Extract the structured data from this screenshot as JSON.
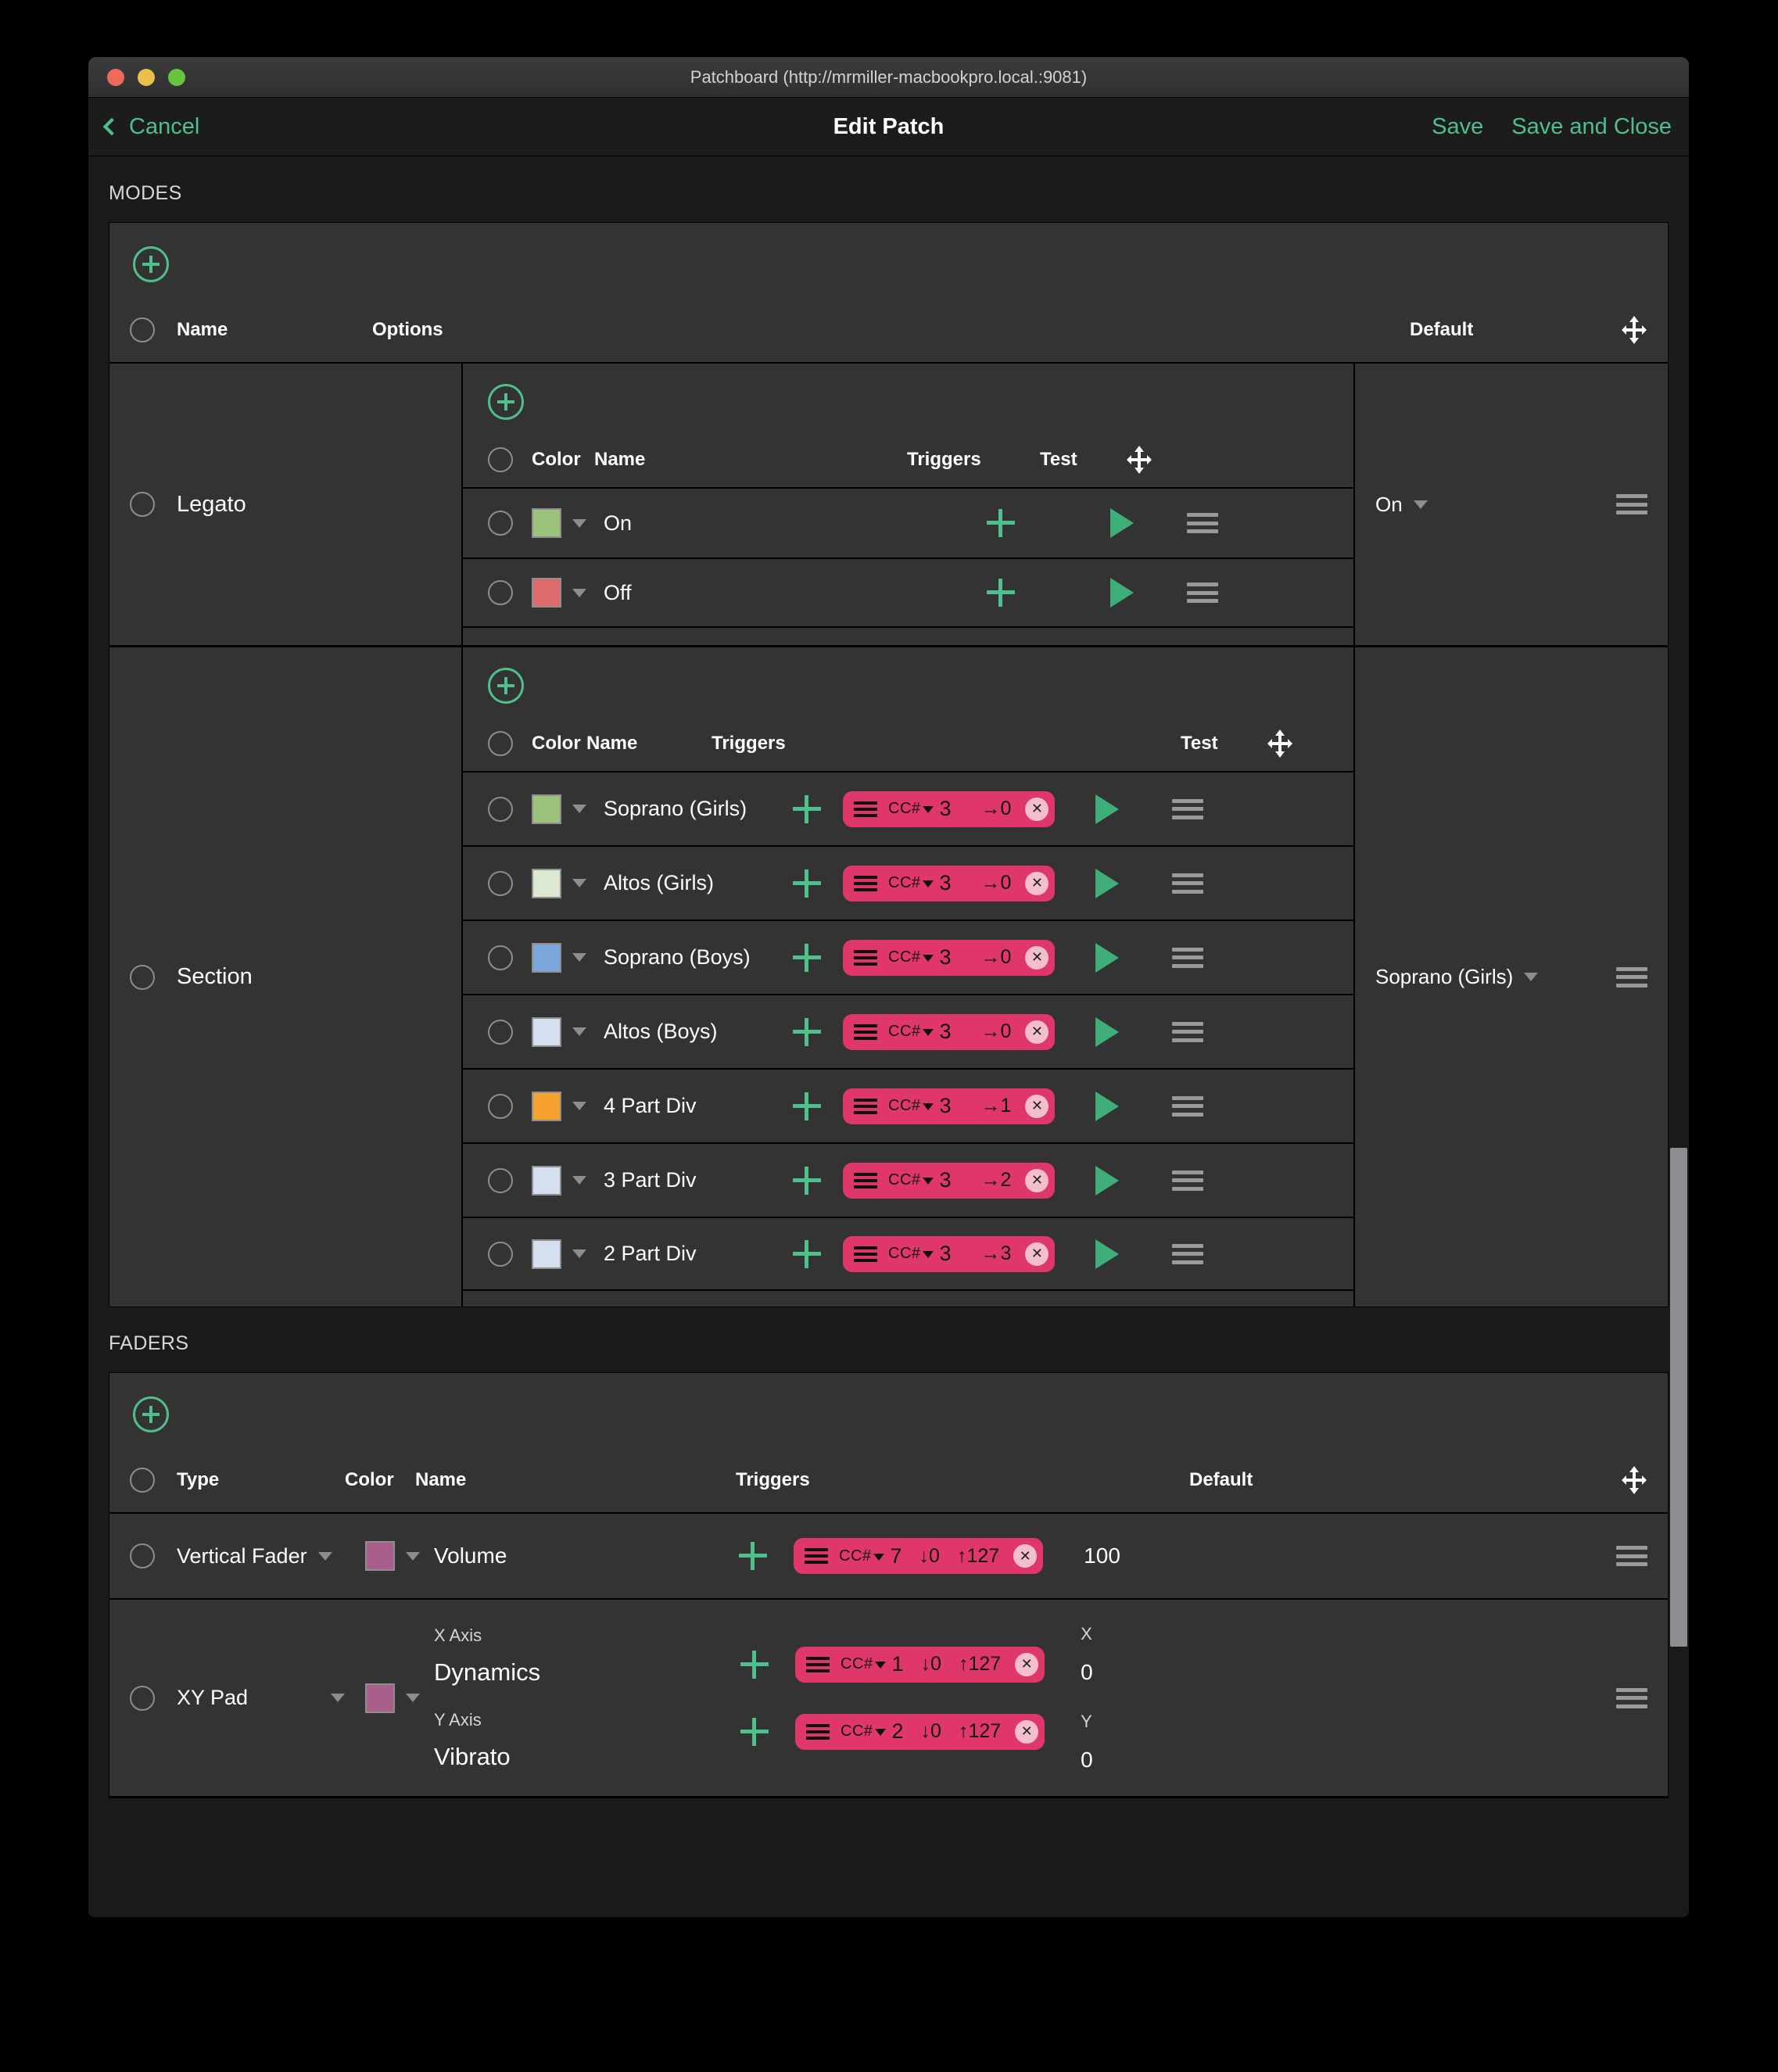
{
  "window": {
    "title": "Patchboard (http://mrmiller-macbookpro.local.:9081)",
    "traffic_lights": [
      "close",
      "minimize",
      "maximize"
    ]
  },
  "navbar": {
    "back_label": "Cancel",
    "title": "Edit Patch",
    "save_label": "Save",
    "save_close_label": "Save and Close"
  },
  "modes": {
    "section_label": "MODES",
    "add_label": "add-mode",
    "columns": {
      "name": "Name",
      "options": "Options",
      "default": "Default"
    },
    "option_columns": {
      "color": "Color",
      "name": "Name",
      "triggers": "Triggers",
      "test": "Test"
    },
    "items": [
      {
        "name": "Legato",
        "default": "On",
        "options": [
          {
            "color": "#9bc37c",
            "name": "On",
            "triggers": []
          },
          {
            "color": "#dd6b6b",
            "name": "Off",
            "triggers": []
          }
        ]
      },
      {
        "name": "Section",
        "default": "Soprano (Girls)",
        "options": [
          {
            "color": "#9bc37c",
            "name": "Soprano (Girls)",
            "triggers": [
              {
                "type": "CC#",
                "number": "3",
                "value": "→0"
              }
            ]
          },
          {
            "color": "#dde8d3",
            "name": "Altos (Girls)",
            "triggers": [
              {
                "type": "CC#",
                "number": "3",
                "value": "→0"
              }
            ]
          },
          {
            "color": "#7ba7dc",
            "name": "Soprano (Boys)",
            "triggers": [
              {
                "type": "CC#",
                "number": "3",
                "value": "→0"
              }
            ]
          },
          {
            "color": "#d4e0f0",
            "name": "Altos (Boys)",
            "triggers": [
              {
                "type": "CC#",
                "number": "3",
                "value": "→0"
              }
            ]
          },
          {
            "color": "#f5a231",
            "name": "4 Part Div",
            "triggers": [
              {
                "type": "CC#",
                "number": "3",
                "value": "→1"
              }
            ]
          },
          {
            "color": "#d4e0f0",
            "name": "3 Part Div",
            "triggers": [
              {
                "type": "CC#",
                "number": "3",
                "value": "→2"
              }
            ]
          },
          {
            "color": "#d4e0f0",
            "name": "2 Part Div",
            "triggers": [
              {
                "type": "CC#",
                "number": "3",
                "value": "→3"
              }
            ]
          }
        ]
      }
    ]
  },
  "faders": {
    "section_label": "FADERS",
    "add_label": "add-fader",
    "columns": {
      "type": "Type",
      "color": "Color",
      "name": "Name",
      "triggers": "Triggers",
      "default": "Default"
    },
    "items": [
      {
        "kind": "single",
        "type": "Vertical Fader",
        "color": "#a8608b",
        "name": "Volume",
        "trigger": {
          "type": "CC#",
          "number": "7",
          "min": "↓0",
          "max": "↑127"
        },
        "default": "100"
      },
      {
        "kind": "xy",
        "type": "XY Pad",
        "color": "#a8608b",
        "axes": [
          {
            "axis_label": "X Axis",
            "name": "Dynamics",
            "default_label": "X",
            "default": "0",
            "trigger": {
              "type": "CC#",
              "number": "1",
              "min": "↓0",
              "max": "↑127"
            }
          },
          {
            "axis_label": "Y Axis",
            "name": "Vibrato",
            "default_label": "Y",
            "default": "0",
            "trigger": {
              "type": "CC#",
              "number": "2",
              "min": "↓0",
              "max": "↑127"
            }
          }
        ]
      }
    ]
  },
  "theme": {
    "accent_green": "#4fbf8b",
    "pill_pink": "#e0376b",
    "panel_bg": "#333333",
    "page_bg": "#1a1a1a"
  }
}
